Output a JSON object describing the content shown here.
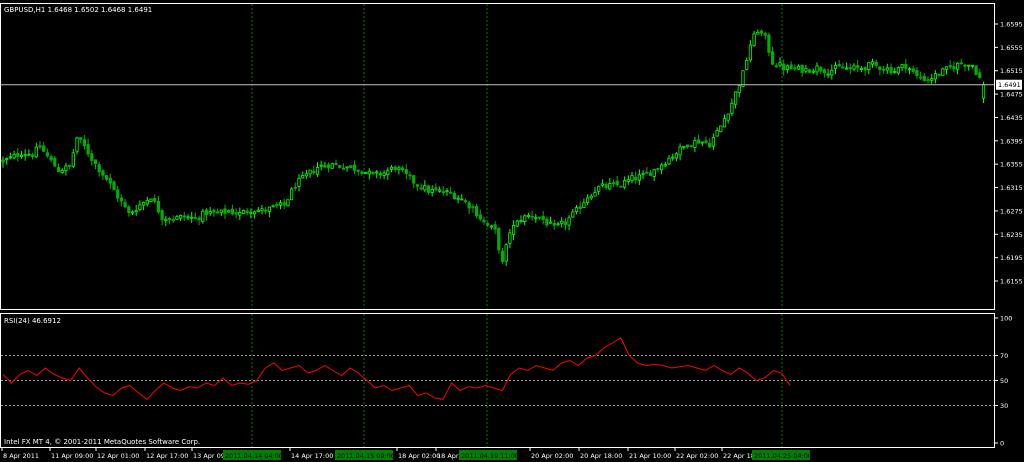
{
  "colors": {
    "background": "#000000",
    "foreground": "#ffffff",
    "candle_up": "#00ff00",
    "candle_down": "#00b000",
    "rsi_line": "#ff0000",
    "separator_grid": "#008000",
    "level_line": "#c0c0c0",
    "marker_bg": "#008000"
  },
  "window": {
    "price_header": "GBPUSD,H1  1.6468 1.6502 1.6468 1.6491",
    "rsi_header": "RSI(24) 46.6912",
    "copyright": "Intel FX MT 4, © 2001-2011 MetaQuotes Software Corp."
  },
  "price_axis": {
    "ticks": [
      "1.6595",
      "1.6555",
      "1.6515",
      "1.6475",
      "1.6435",
      "1.6395",
      "1.6355",
      "1.6315",
      "1.6275",
      "1.6235",
      "1.6195",
      "1.6155"
    ],
    "tick_values": [
      1.6595,
      1.6555,
      1.6515,
      1.6475,
      1.6435,
      1.6395,
      1.6355,
      1.6315,
      1.6275,
      1.6235,
      1.6195,
      1.6155
    ],
    "current_price": "1.6491"
  },
  "rsi_axis": {
    "ticks": [
      "100",
      "70",
      "50",
      "30",
      "0"
    ],
    "tick_values": [
      100,
      70,
      50,
      30,
      0
    ],
    "levels": [
      70,
      50,
      30
    ]
  },
  "time_axis": {
    "labels": [
      "8 Apr 2011",
      "11 Apr 09:00",
      "12 Apr 01:00",
      "12 Apr 17:00",
      "13 Apr 09:00",
      "14 Apr 17:00",
      "18 Apr 02:00",
      "18 Apr 18:00",
      "20 Apr 02:00",
      "20 Apr 18:00",
      "21 Apr 10:00",
      "22 Apr 02:00",
      "22 Apr 18:00"
    ],
    "markers": [
      "2011.04.14 04:00",
      "2011.04.15 09:00",
      "2011.04.19 11:00",
      "2011.04.25 04:00"
    ]
  },
  "chart_data": [
    {
      "type": "candlestick",
      "symbol": "GBPUSD",
      "timeframe": "H1",
      "last_bar": {
        "open": 1.6468,
        "high": 1.6502,
        "low": 1.6468,
        "close": 1.6491
      },
      "ylim": [
        1.614,
        1.6615
      ],
      "current_price": 1.6491,
      "close_path": [
        [
          0,
          1.636
        ],
        [
          2,
          1.6365
        ],
        [
          5,
          1.6375
        ],
        [
          8,
          1.6372
        ],
        [
          10,
          1.6385
        ],
        [
          13,
          1.636
        ],
        [
          15,
          1.6345
        ],
        [
          18,
          1.635
        ],
        [
          20,
          1.64
        ],
        [
          22,
          1.6385
        ],
        [
          25,
          1.6355
        ],
        [
          28,
          1.633
        ],
        [
          31,
          1.63
        ],
        [
          34,
          1.627
        ],
        [
          37,
          1.6285
        ],
        [
          40,
          1.63
        ],
        [
          43,
          1.6265
        ],
        [
          46,
          1.6262
        ],
        [
          49,
          1.6265
        ],
        [
          52,
          1.6262
        ],
        [
          55,
          1.6272
        ],
        [
          58,
          1.627
        ],
        [
          61,
          1.6275
        ],
        [
          64,
          1.627
        ],
        [
          67,
          1.6278
        ],
        [
          70,
          1.6275
        ],
        [
          73,
          1.628
        ],
        [
          76,
          1.6285
        ],
        [
          79,
          1.632
        ],
        [
          82,
          1.6335
        ],
        [
          85,
          1.635
        ],
        [
          88,
          1.6355
        ],
        [
          91,
          1.6352
        ],
        [
          94,
          1.635
        ],
        [
          97,
          1.6345
        ],
        [
          100,
          1.6335
        ],
        [
          103,
          1.634
        ],
        [
          106,
          1.635
        ],
        [
          109,
          1.6335
        ],
        [
          112,
          1.632
        ],
        [
          115,
          1.631
        ],
        [
          118,
          1.6308
        ],
        [
          121,
          1.6305
        ],
        [
          124,
          1.6295
        ],
        [
          127,
          1.628
        ],
        [
          130,
          1.6255
        ],
        [
          133,
          1.624
        ],
        [
          135,
          1.6185
        ],
        [
          137,
          1.624
        ],
        [
          140,
          1.6262
        ],
        [
          143,
          1.6268
        ],
        [
          146,
          1.626
        ],
        [
          149,
          1.6245
        ],
        [
          152,
          1.6255
        ],
        [
          155,
          1.6275
        ],
        [
          158,
          1.63
        ],
        [
          161,
          1.6315
        ],
        [
          164,
          1.6318
        ],
        [
          167,
          1.632
        ],
        [
          170,
          1.633
        ],
        [
          173,
          1.6335
        ],
        [
          176,
          1.6345
        ],
        [
          179,
          1.636
        ],
        [
          182,
          1.6375
        ],
        [
          185,
          1.639
        ],
        [
          188,
          1.6395
        ],
        [
          191,
          1.639
        ],
        [
          194,
          1.642
        ],
        [
          197,
          1.646
        ],
        [
          200,
          1.651
        ],
        [
          202,
          1.656
        ],
        [
          204,
          1.6585
        ],
        [
          206,
          1.657
        ],
        [
          208,
          1.653
        ],
        [
          211,
          1.652
        ],
        [
          214,
          1.6518
        ],
        [
          217,
          1.6517
        ],
        [
          220,
          1.652
        ],
        [
          223,
          1.6515
        ],
        [
          226,
          1.652
        ],
        [
          229,
          1.6518
        ],
        [
          232,
          1.652
        ],
        [
          235,
          1.6525
        ],
        [
          238,
          1.652
        ],
        [
          241,
          1.6515
        ],
        [
          244,
          1.6525
        ],
        [
          247,
          1.6505
        ],
        [
          250,
          1.65
        ],
        [
          253,
          1.651
        ],
        [
          256,
          1.652
        ],
        [
          259,
          1.6528
        ],
        [
          262,
          1.6525
        ],
        [
          265,
          1.6491
        ]
      ]
    },
    {
      "type": "line",
      "title": "RSI(24) 46.6912",
      "ylim": [
        0,
        100
      ],
      "levels": [
        70,
        50,
        30
      ],
      "series": [
        {
          "name": "RSI(24)",
          "values": [
            55,
            48,
            55,
            58,
            54,
            60,
            55,
            52,
            50,
            60,
            52,
            45,
            40,
            38,
            44,
            46,
            40,
            35,
            42,
            48,
            44,
            42,
            45,
            44,
            48,
            46,
            52,
            46,
            48,
            47,
            50,
            60,
            64,
            58,
            60,
            62,
            56,
            58,
            62,
            58,
            54,
            60,
            56,
            50,
            44,
            46,
            42,
            44,
            46,
            38,
            40,
            36,
            35,
            48,
            42,
            45,
            44,
            46,
            44,
            42,
            55,
            60,
            58,
            62,
            60,
            58,
            64,
            66,
            62,
            68,
            70,
            76,
            80,
            84,
            70,
            64,
            62,
            63,
            62,
            60,
            61,
            62,
            60,
            58,
            62,
            58,
            55,
            60,
            56,
            50,
            52,
            58,
            56,
            46
          ]
        }
      ]
    }
  ]
}
